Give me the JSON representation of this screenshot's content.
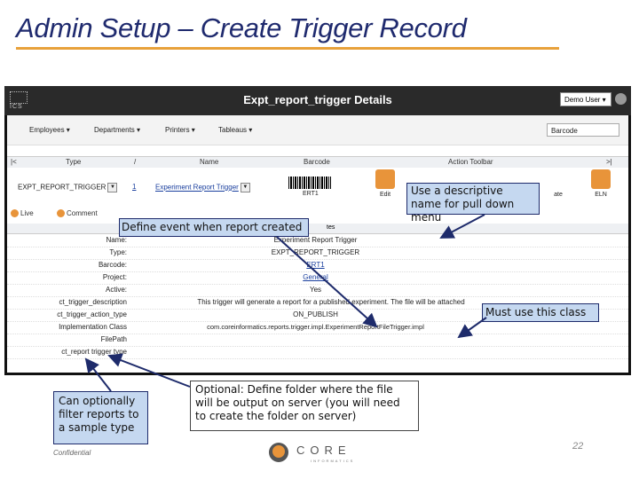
{
  "slide": {
    "title": "Admin Setup – Create Trigger Record",
    "confidential": "Confidential",
    "page_number": "22",
    "logo_text": "CORE",
    "logo_subtext": "INFORMATICS"
  },
  "app": {
    "brand": "ICS",
    "window_title": "Expt_report_trigger Details",
    "user_menu": "Demo User",
    "menu": [
      "Employees",
      "Departments",
      "Printers",
      "Tableaus"
    ],
    "barcode_search_placeholder": "Barcode"
  },
  "grid": {
    "headers": [
      "|<",
      "Type",
      "/",
      "Name",
      "Barcode",
      "Action Toolbar",
      ">|"
    ],
    "row": {
      "type": "EXPT_REPORT_TRIGGER",
      "slash": "1",
      "name": "Experiment Report Trigger",
      "barcode_number": "ERT1"
    },
    "actions": [
      "Edit",
      "ate",
      "ELN"
    ]
  },
  "tabs": [
    "Live",
    "Comment"
  ],
  "details": {
    "header": "tes",
    "rows": [
      {
        "label": "Name:",
        "value": "Experiment Report Trigger"
      },
      {
        "label": "Type:",
        "value": "EXPT_REPORT_TRIGGER"
      },
      {
        "label": "Barcode:",
        "value": "ERT1"
      },
      {
        "label": "Project:",
        "value": "General"
      },
      {
        "label": "Active:",
        "value": "Yes"
      },
      {
        "label": "ct_trigger_description",
        "value": "This trigger will generate a report for a published experiment. The file will be attached"
      },
      {
        "label": "ct_trigger_action_type",
        "value": "ON_PUBLISH"
      },
      {
        "label": "Implementation Class",
        "value": "com.coreinformatics.reports.trigger.impl.ExperimentReportFileTrigger.impl"
      },
      {
        "label": "FilePath",
        "value": ""
      },
      {
        "label": "ct_report trigger type",
        "value": ""
      }
    ]
  },
  "callouts": {
    "descriptive_name": "Use a descriptive name for pull down menu",
    "define_event": "Define event when report created",
    "must_use_class": "Must use this class",
    "optional_filter": "Can optionally filter reports to a sample type",
    "optional_folder": "Optional: Define folder where the file will be output on server (you will need to create the folder on server)"
  },
  "colors": {
    "title": "#1f2a6e",
    "title_rule": "#e8a13a",
    "callout_fill": "#c5d8f0",
    "callout_border": "#1e2b6b",
    "arrow": "#1e2b6b",
    "app_header": "#2a2a2a"
  }
}
